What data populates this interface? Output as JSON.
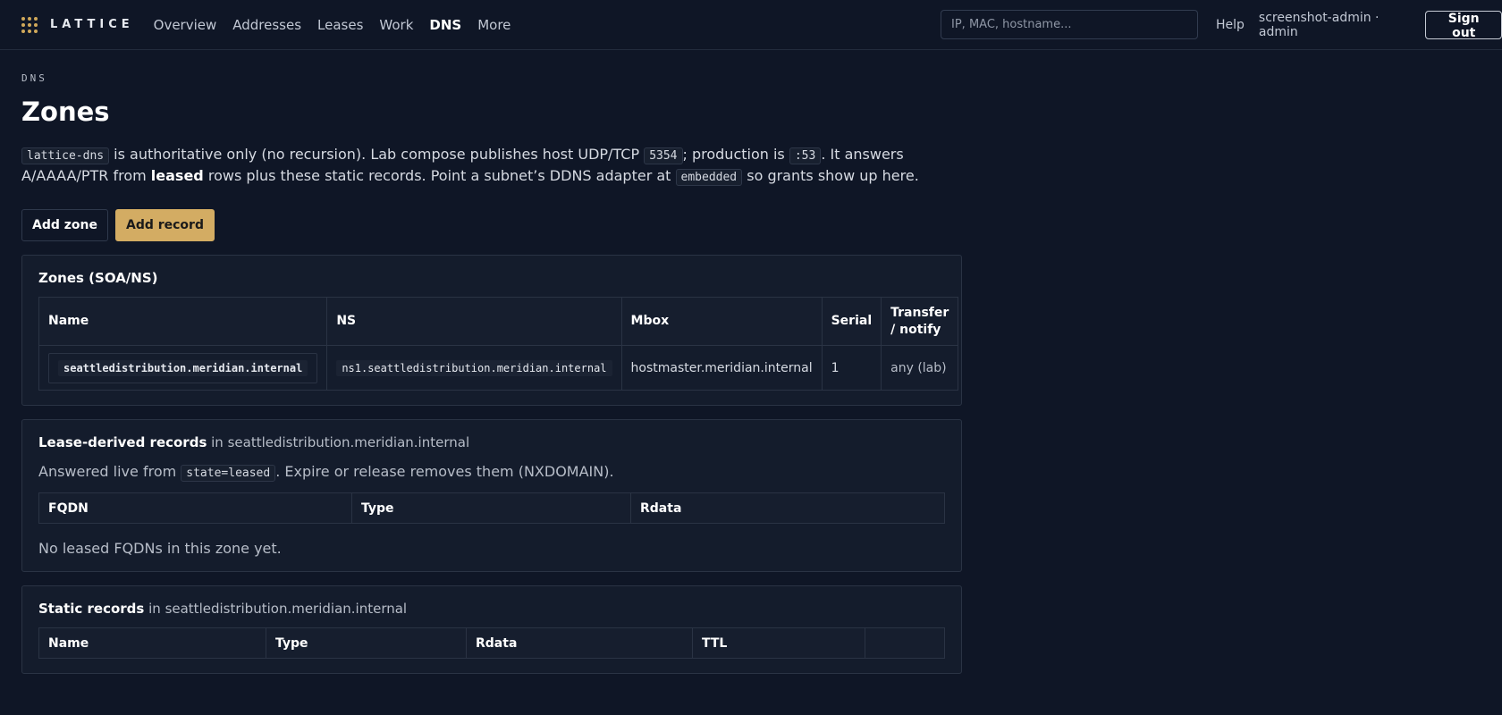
{
  "header": {
    "logo_text": "LATTICE",
    "nav": [
      {
        "label": "Overview",
        "active": false
      },
      {
        "label": "Addresses",
        "active": false
      },
      {
        "label": "Leases",
        "active": false
      },
      {
        "label": "Work",
        "active": false
      },
      {
        "label": "DNS",
        "active": true
      },
      {
        "label": "More",
        "active": false
      }
    ],
    "search_placeholder": "IP, MAC, hostname...",
    "help_label": "Help",
    "user_label": "screenshot-admin · admin",
    "signout_label": "Sign out"
  },
  "page": {
    "eyebrow": "DNS",
    "title": "Zones",
    "intro": {
      "code1": "lattice-dns",
      "t1": " is authoritative only (no recursion). Lab compose publishes host UDP/TCP ",
      "code2": "5354",
      "t2": "; production is ",
      "code3": ":53",
      "t3": ". It answers A/AAAA/PTR from ",
      "bold": "leased",
      "t4": " rows plus these static records. Point a subnet’s DDNS adapter at ",
      "code4": "embedded",
      "t5": " so grants show up here."
    },
    "add_zone_label": "Add zone",
    "add_record_label": "Add record"
  },
  "zones_panel": {
    "title": "Zones (SOA/NS)",
    "headers": [
      "Name",
      "NS",
      "Mbox",
      "Serial",
      "Transfer / notify"
    ],
    "rows": [
      {
        "name": "seattledistribution.meridian.internal",
        "ns": "ns1.seattledistribution.meridian.internal",
        "mbox": "hostmaster.meridian.internal",
        "serial": "1",
        "transfer": "any (lab)"
      }
    ]
  },
  "lease_panel": {
    "title": "Lease-derived records",
    "title_suffix": " in seattledistribution.meridian.internal",
    "desc_pre": "Answered live from ",
    "desc_code": "state=leased",
    "desc_post": ". Expire or release removes them (NXDOMAIN).",
    "headers": [
      "FQDN",
      "Type",
      "Rdata"
    ],
    "empty": "No leased FQDNs in this zone yet."
  },
  "static_panel": {
    "title": "Static records",
    "title_suffix": " in seattledistribution.meridian.internal",
    "headers": [
      "Name",
      "Type",
      "Rdata",
      "TTL",
      ""
    ]
  },
  "colors": {
    "background": "#0f1626",
    "accent": "#d3ac63",
    "panel": "#141c2c"
  }
}
